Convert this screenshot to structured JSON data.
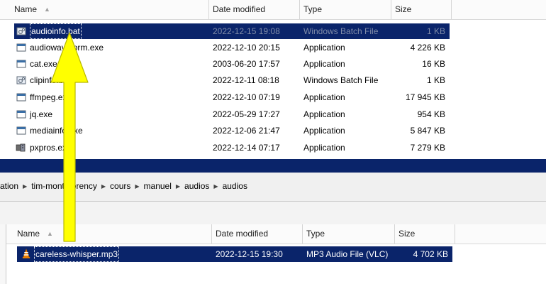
{
  "top_pane": {
    "columns": {
      "name": "Name",
      "date": "Date modified",
      "type": "Type",
      "size": "Size"
    },
    "files": [
      {
        "name": "audioinfo.bat",
        "date": "2022-12-15 19:08",
        "type": "Windows Batch File",
        "size": "1 KB",
        "icon": "batch-file-icon",
        "selected": true
      },
      {
        "name": "audiowaveform.exe",
        "date": "2022-12-10 20:15",
        "type": "Application",
        "size": "4 226 KB",
        "icon": "application-icon"
      },
      {
        "name": "cat.exe",
        "date": "2003-06-20 17:57",
        "type": "Application",
        "size": "16 KB",
        "icon": "application-icon"
      },
      {
        "name": "clipinfo.bat",
        "date": "2022-12-11 08:18",
        "type": "Windows Batch File",
        "size": "1 KB",
        "icon": "batch-file-icon"
      },
      {
        "name": "ffmpeg.exe",
        "date": "2022-12-10 07:19",
        "type": "Application",
        "size": "17 945 KB",
        "icon": "application-icon"
      },
      {
        "name": "jq.exe",
        "date": "2022-05-29 17:27",
        "type": "Application",
        "size": "954 KB",
        "icon": "application-icon"
      },
      {
        "name": "mediainfo.exe",
        "date": "2022-12-06 21:47",
        "type": "Application",
        "size": "5 847 KB",
        "icon": "application-icon"
      },
      {
        "name": "pxpros.exe",
        "date": "2022-12-14 07:17",
        "type": "Application",
        "size": "7 279 KB",
        "icon": "pxpros-app-icon"
      }
    ]
  },
  "breadcrumb": [
    "ation",
    "tim-montmorency",
    "cours",
    "manuel",
    "audios",
    "audios"
  ],
  "bottom_pane": {
    "columns": {
      "name": "Name",
      "date": "Date modified",
      "type": "Type",
      "size": "Size"
    },
    "files": [
      {
        "name": "careless-whisper.mp3",
        "date": "2022-12-15 19:30",
        "type": "MP3 Audio File (VLC)",
        "size": "4 702 KB",
        "icon": "vlc-cone-icon",
        "selected": true
      }
    ]
  },
  "colors": {
    "selection": "#0a246a",
    "arrow": "#ffff00",
    "arrow_outline": "#b8b800"
  }
}
